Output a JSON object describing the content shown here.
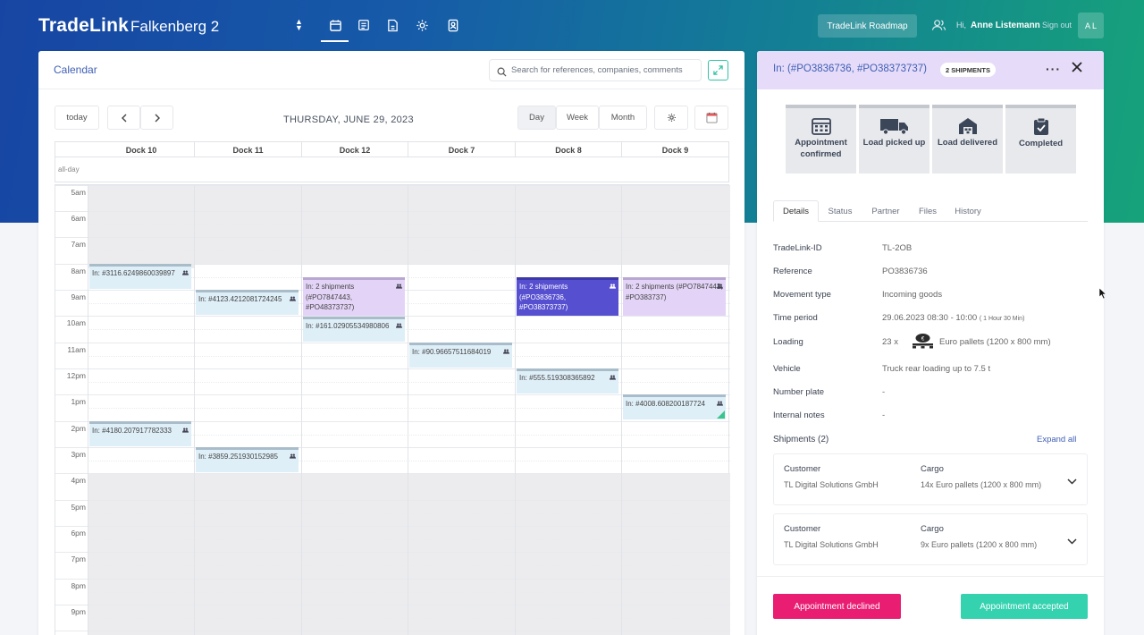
{
  "header": {
    "brand": "TradeLink",
    "site": "Falkenberg 2",
    "roadmap_label": "TradeLink Roadmap",
    "greeting": "Hi,",
    "user_name": "Anne Listemann",
    "signout_label": "Sign out",
    "avatar_initials": "A L"
  },
  "calendar": {
    "title": "Calendar",
    "search_placeholder": "Search for references, companies, comments",
    "today_label": "today",
    "date_title": "THURSDAY, JUNE 29, 2023",
    "views": [
      "Day",
      "Week",
      "Month"
    ],
    "active_view": "Day",
    "allday_label": "all-day",
    "docks": [
      "Dock 10",
      "Dock 11",
      "Dock 12",
      "Dock 7",
      "Dock 8",
      "Dock 9"
    ],
    "times": [
      "5am",
      "6am",
      "7am",
      "8am",
      "9am",
      "10am",
      "11am",
      "12pm",
      "1pm",
      "2pm",
      "3pm",
      "4pm",
      "5pm",
      "6pm",
      "7pm",
      "8pm",
      "9pm"
    ],
    "events": [
      {
        "text": "In: #3116.6249860039897"
      },
      {
        "text": "In: #4123.4212081724245"
      },
      {
        "text": "In: 2 shipments (#PO7847443, #PO48373737)"
      },
      {
        "text": "In: #161.02905534980806"
      },
      {
        "text": "In: #90.96657511684019"
      },
      {
        "text": "In: 2 shipments (#PO3836736, #PO38373737)"
      },
      {
        "text": "In: #555.519308365892"
      },
      {
        "text": "In: 2 shipments (#PO7847443, #PO383737)"
      },
      {
        "text": "In: #4008.608200187724"
      },
      {
        "text": "In: #4180.207917782333"
      },
      {
        "text": "In: #3859.251930152985"
      }
    ]
  },
  "panel": {
    "title": "In: (#PO3836736, #PO38373737)",
    "badge": "2 SHIPMENTS",
    "steps": [
      "Appointment confirmed",
      "Load picked up",
      "Load delivered",
      "Completed"
    ],
    "tabs": [
      "Details",
      "Status",
      "Partner",
      "Files",
      "History"
    ],
    "active_tab": "Details",
    "details": [
      {
        "label": "TradeLink-ID",
        "value": "TL-2OB"
      },
      {
        "label": "Reference",
        "value": "PO3836736"
      },
      {
        "label": "Movement type",
        "value": "Incoming goods"
      },
      {
        "label": "Time period",
        "value": "29.06.2023 08:30 - 10:00",
        "note": "( 1 Hour 30 Min)"
      },
      {
        "label": "Loading",
        "value": "23 x",
        "value2": "Euro pallets (1200 x 800 mm)"
      },
      {
        "label": "Vehicle",
        "value": "Truck rear loading up to 7.5 t"
      },
      {
        "label": "Number plate",
        "value": "-"
      },
      {
        "label": "Internal notes",
        "value": "-"
      }
    ],
    "shipments_title": "Shipments (2)",
    "expand_all": "Expand all",
    "shipments": [
      {
        "customer_label": "Customer",
        "customer": "TL Digital Solutions GmbH",
        "cargo_label": "Cargo",
        "cargo": "14x Euro pallets (1200 x 800 mm)"
      },
      {
        "customer_label": "Customer",
        "customer": "TL Digital Solutions GmbH",
        "cargo_label": "Cargo",
        "cargo": "9x Euro pallets (1200 x 800 mm)"
      }
    ],
    "decline_label": "Appointment declined",
    "accept_label": "Appointment accepted"
  }
}
